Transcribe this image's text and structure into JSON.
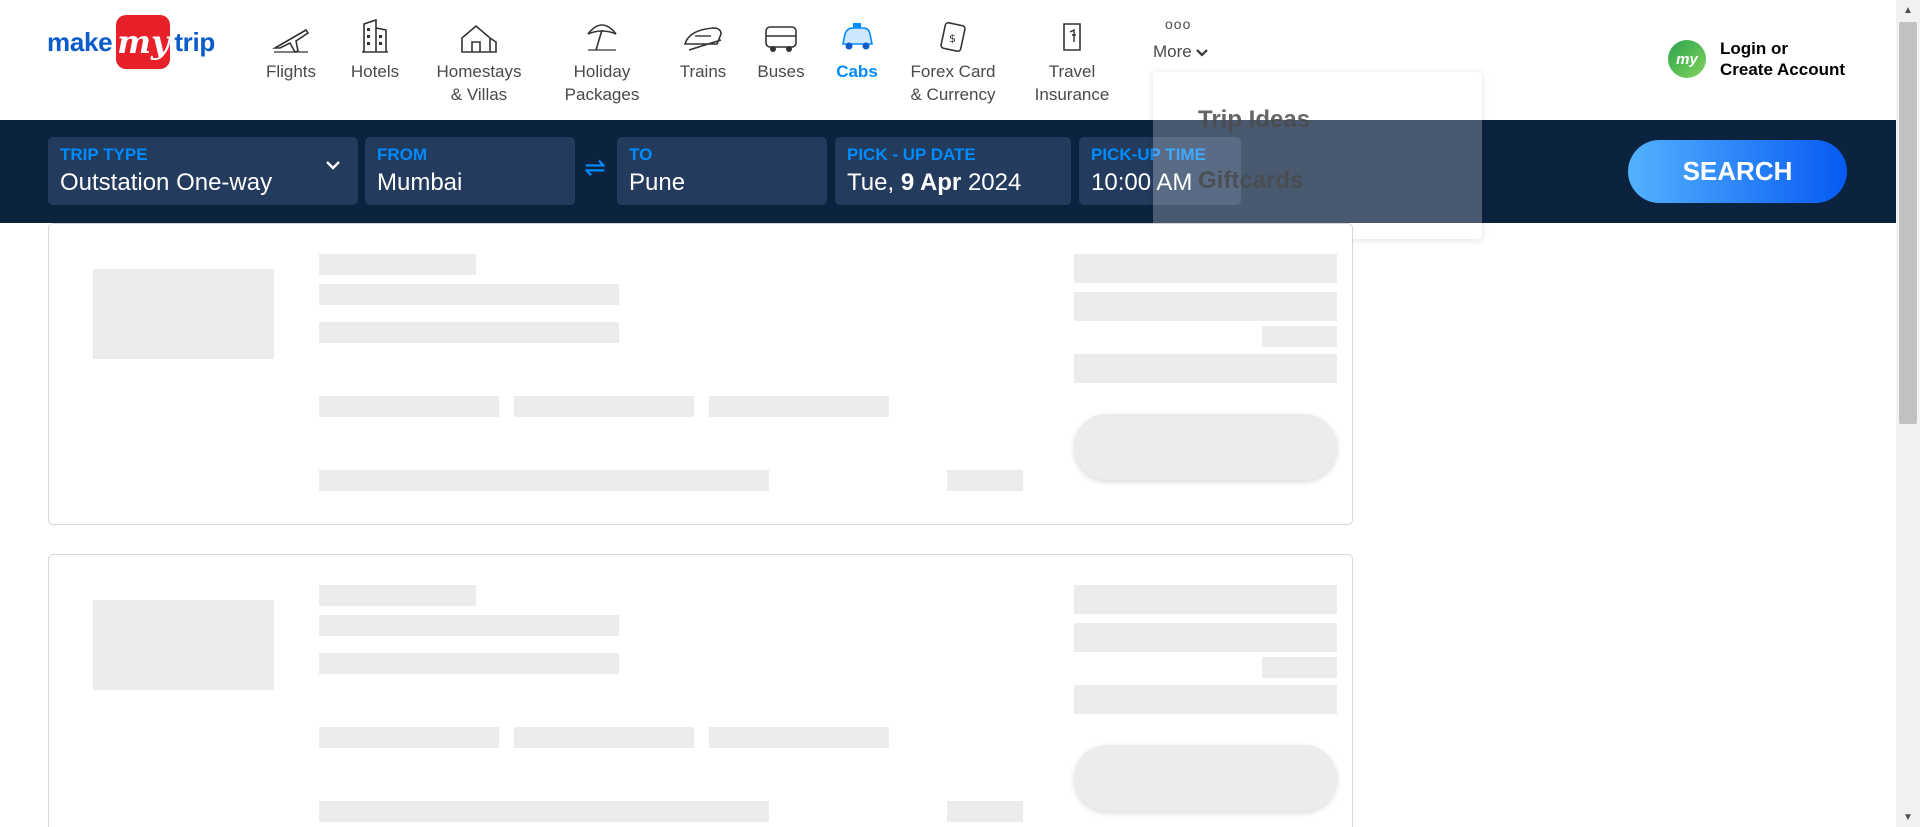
{
  "brand": {
    "part1": "make",
    "badge": "my",
    "part2": "trip"
  },
  "nav": {
    "items": [
      {
        "label": "Flights",
        "icon": "plane-icon"
      },
      {
        "label": "Hotels",
        "icon": "hotel-icon"
      },
      {
        "label": "Homestays\n& Villas",
        "icon": "homestay-icon"
      },
      {
        "label": "Holiday\nPackages",
        "icon": "umbrella-icon"
      },
      {
        "label": "Trains",
        "icon": "train-icon"
      },
      {
        "label": "Buses",
        "icon": "bus-icon"
      },
      {
        "label": "Cabs",
        "icon": "cab-icon",
        "active": true
      },
      {
        "label": "Forex Card\n& Currency",
        "icon": "forex-icon"
      },
      {
        "label": "Travel\nInsurance",
        "icon": "insurance-icon"
      }
    ],
    "more": {
      "dots": "ooo",
      "label": "More"
    }
  },
  "login": {
    "avatar": "my",
    "line1": "Login or",
    "line2": "Create Account"
  },
  "search": {
    "trip_type": {
      "label": "TRIP TYPE",
      "value": "Outstation One-way"
    },
    "from": {
      "label": "FROM",
      "value": "Mumbai"
    },
    "to": {
      "label": "TO",
      "value": "Pune"
    },
    "pickup_date": {
      "label": "PICK - UP DATE",
      "day": "Tue,",
      "date": "9 Apr",
      "year": "2024"
    },
    "pickup_time": {
      "label": "PICK-UP TIME",
      "value": "10:00 AM"
    },
    "swap_symbol": "⇌",
    "button": "SEARCH"
  },
  "more_menu": {
    "items": [
      "Trip Ideas",
      "Giftcards"
    ]
  },
  "colors": {
    "accent": "#008cff",
    "header_bg": "#0c2340",
    "field_bg": "#233b5c",
    "brand_red": "#e8202a"
  }
}
